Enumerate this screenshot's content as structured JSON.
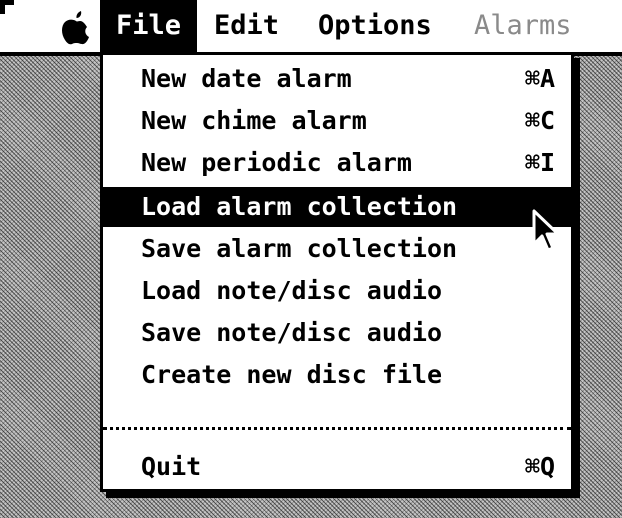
{
  "menubar": {
    "menus": [
      {
        "label": "File"
      },
      {
        "label": "Edit"
      },
      {
        "label": "Options"
      },
      {
        "label": "Alarms"
      }
    ]
  },
  "file_menu": {
    "items": [
      {
        "label": "New date alarm",
        "shortcut": "⌘A"
      },
      {
        "label": "New chime alarm",
        "shortcut": "⌘C"
      },
      {
        "label": "New periodic alarm",
        "shortcut": "⌘I"
      },
      {
        "label": "Load alarm collection",
        "shortcut": ""
      },
      {
        "label": "Save alarm collection",
        "shortcut": ""
      },
      {
        "label": "Load note/disc audio",
        "shortcut": ""
      },
      {
        "label": "Save note/disc audio",
        "shortcut": ""
      },
      {
        "label": "Create new disc file",
        "shortcut": ""
      },
      {
        "label": "Quit",
        "shortcut": "⌘Q"
      }
    ],
    "highlighted_index": 3
  },
  "icons": {
    "apple": "apple-logo-icon",
    "cursor": "arrow-cursor-icon"
  }
}
